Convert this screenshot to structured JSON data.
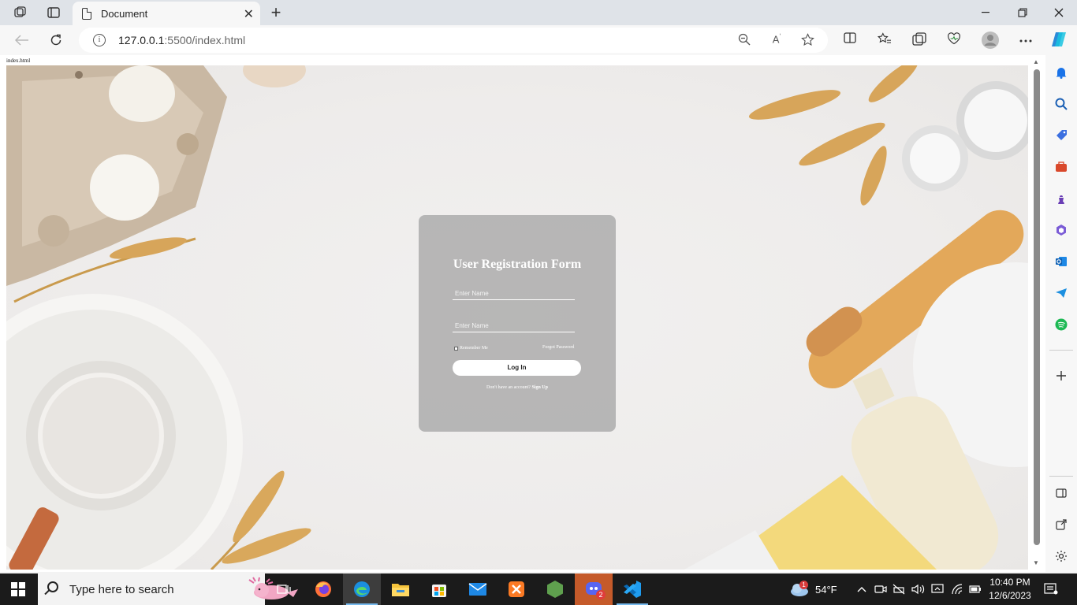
{
  "browser": {
    "tab_title": "Document",
    "url_host": "127.0.0.1",
    "url_rest": ":5500/index.html",
    "tab_close": "✕",
    "new_tab": "+"
  },
  "page": {
    "file_label": "index.html",
    "form": {
      "title": "User Registration Form",
      "field1_placeholder": "Enter Name",
      "field2_placeholder": "Enter Name",
      "remember_label": "Remember Me",
      "forgot_label": "Forgot Password",
      "login_label": "Log In",
      "signup_prompt": "Don't have an account?",
      "signup_link": "Sign Up"
    }
  },
  "taskbar": {
    "search_placeholder": "Type here to search",
    "weather": "54°F",
    "time": "10:40 PM",
    "date": "12/6/2023",
    "discord_badge": "2",
    "weather_badge": "1"
  },
  "colors": {
    "card": "#aaaaaa",
    "accent": "#0078d4",
    "taskbar": "#1b1b1b"
  }
}
